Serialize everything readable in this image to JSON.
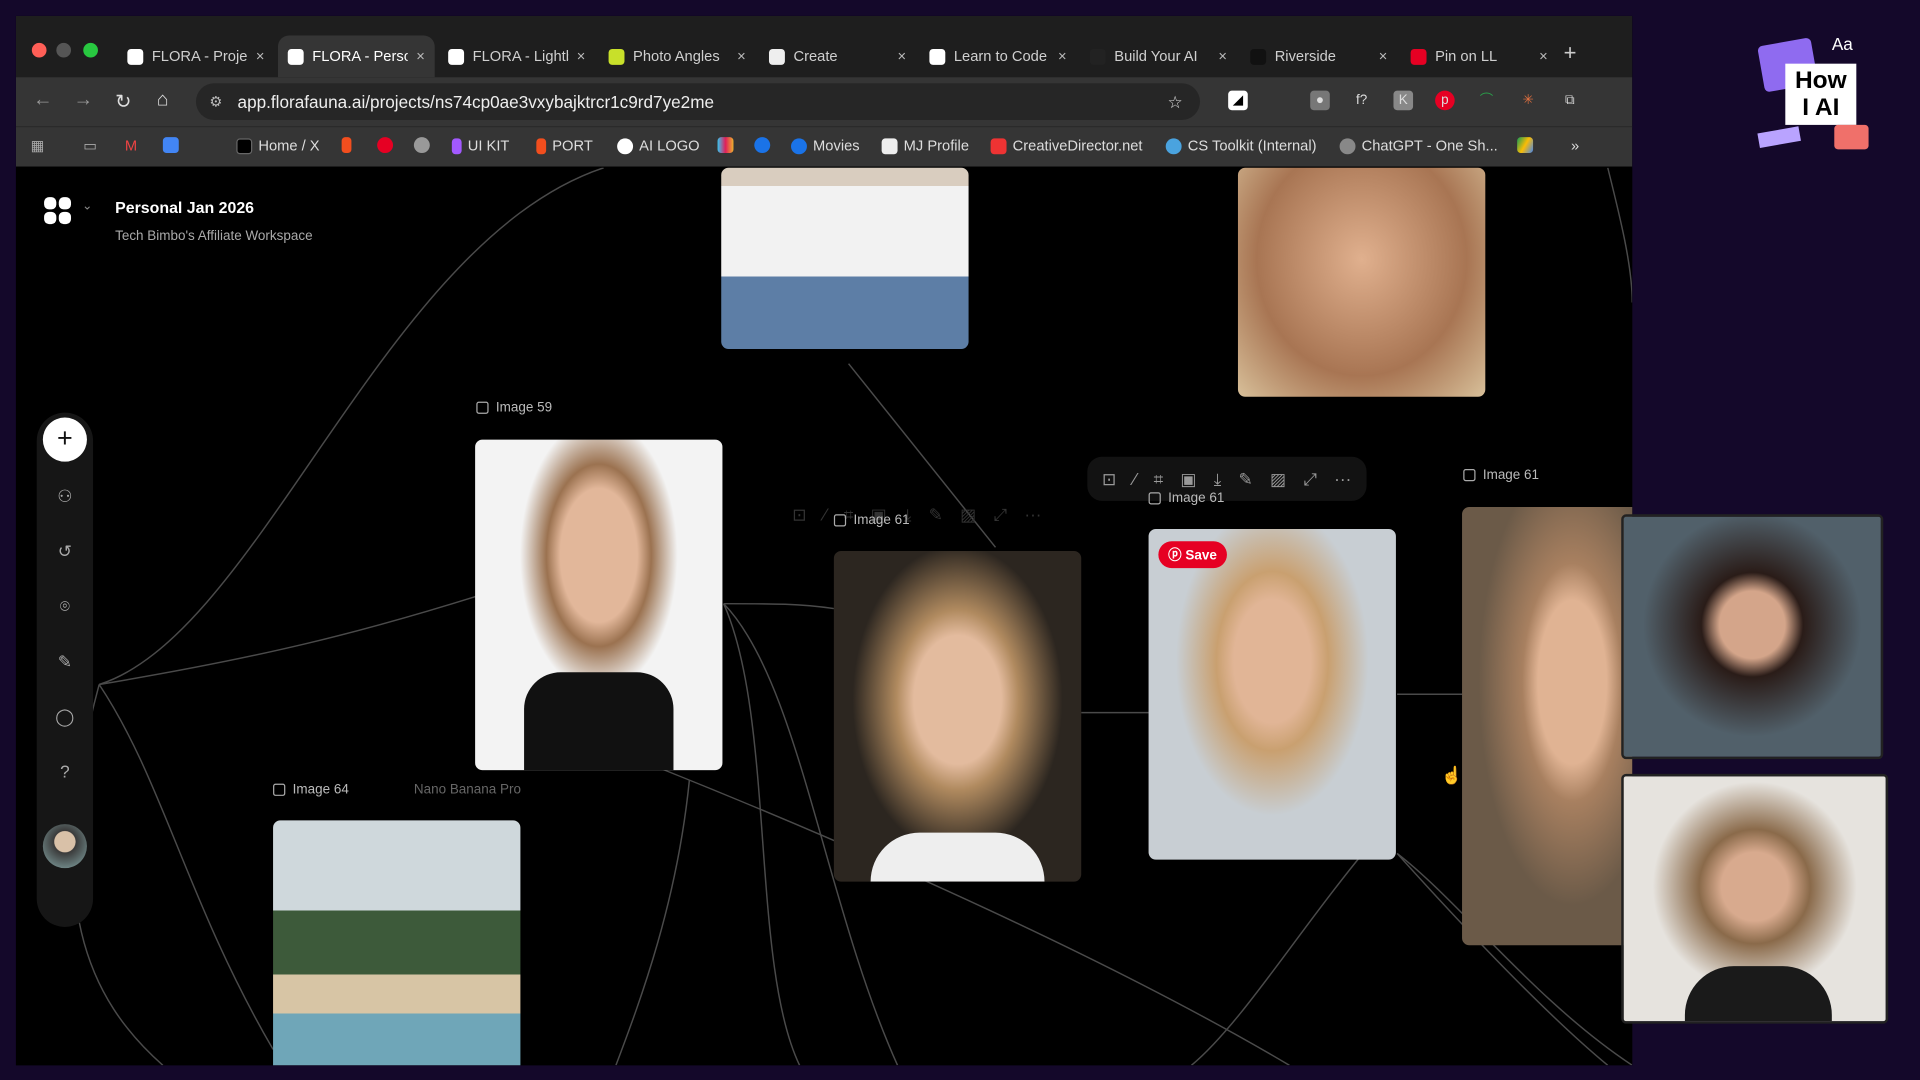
{
  "browser": {
    "tabs": [
      {
        "title": "FLORA - Project",
        "active": false
      },
      {
        "title": "FLORA - Personal",
        "active": true
      },
      {
        "title": "FLORA - Lightbox",
        "active": false
      },
      {
        "title": "Photo Angles",
        "active": false
      },
      {
        "title": "Create",
        "active": false
      },
      {
        "title": "Learn to Code",
        "active": false
      },
      {
        "title": "Build Your AI",
        "active": false
      },
      {
        "title": "Riverside",
        "active": false
      },
      {
        "title": "Pin on LL",
        "active": false
      }
    ],
    "url": "app.florafauna.ai/projects/ns74cp0ae3vxybajktrcr1c9rd7ye2me",
    "bookmarks": [
      "Home / X",
      "UI KIT",
      "PORT",
      "AI LOGO",
      "Movies",
      "MJ Profile",
      "CreativeDirector.net",
      "CS Toolkit (Internal)",
      "ChatGPT - One Sh..."
    ],
    "close_glyph": "×",
    "more_glyph": "»"
  },
  "workspace": {
    "title": "Personal Jan 2026",
    "subtitle": "Tech Bimbo's Affiliate Workspace"
  },
  "rail": {
    "add": "+",
    "icons": [
      "shapes-icon",
      "history-icon",
      "scan-icon",
      "brush-icon",
      "chat-icon",
      "help-icon"
    ]
  },
  "nodes": {
    "image59": "Image 59",
    "image61a": "Image 61",
    "image61b": "Image 61",
    "image61c": "Image 61",
    "image64": "Image 64",
    "image64_model": "Nano Banana Pro"
  },
  "pinterest_save": "Save",
  "node_toolbar_more": "···",
  "brand": {
    "line1": "How",
    "line2": "I AI",
    "aa": "Aa"
  },
  "colors": {
    "accent": "#e60023",
    "frame": "#14082a"
  }
}
